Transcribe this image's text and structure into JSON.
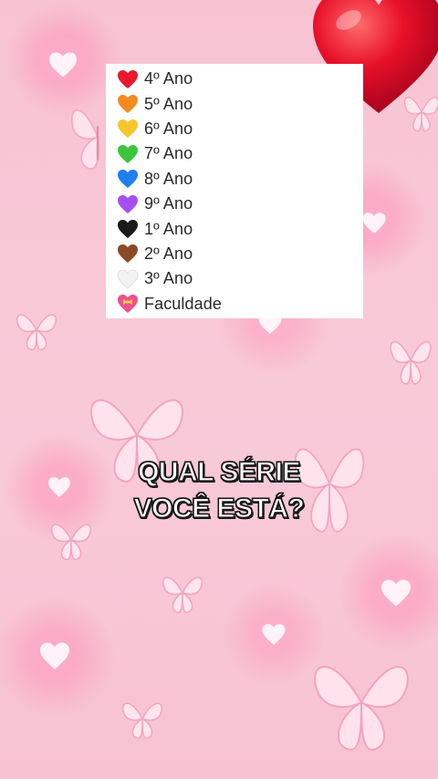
{
  "series_list": [
    {
      "label": "4º Ano",
      "heart_icon": "red-heart-icon",
      "color": "#e8192c"
    },
    {
      "label": "5º Ano",
      "heart_icon": "orange-heart-icon",
      "color": "#f58a1f"
    },
    {
      "label": "6º Ano",
      "heart_icon": "yellow-heart-icon",
      "color": "#f7c62d"
    },
    {
      "label": "7º Ano",
      "heart_icon": "green-heart-icon",
      "color": "#3cc43c"
    },
    {
      "label": "8º Ano",
      "heart_icon": "blue-heart-icon",
      "color": "#1f7ff0"
    },
    {
      "label": "9º Ano",
      "heart_icon": "purple-heart-icon",
      "color": "#a64ff0"
    },
    {
      "label": "1º Ano",
      "heart_icon": "black-heart-icon",
      "color": "#1a1a1a"
    },
    {
      "label": "2º Ano",
      "heart_icon": "brown-heart-icon",
      "color": "#8a4a26"
    },
    {
      "label": "3º Ano",
      "heart_icon": "white-heart-icon",
      "color": "#f2f2f2"
    },
    {
      "label": "Faculdade",
      "heart_icon": "heart-with-ribbon-icon",
      "color": "#f0508a"
    }
  ],
  "caption": {
    "line1": "QUAL SÉRIE",
    "line2": "VOCÊ ESTÁ?"
  },
  "decor": {
    "big_heart_color": "#e8102a",
    "background_color": "#f7c6d6"
  }
}
